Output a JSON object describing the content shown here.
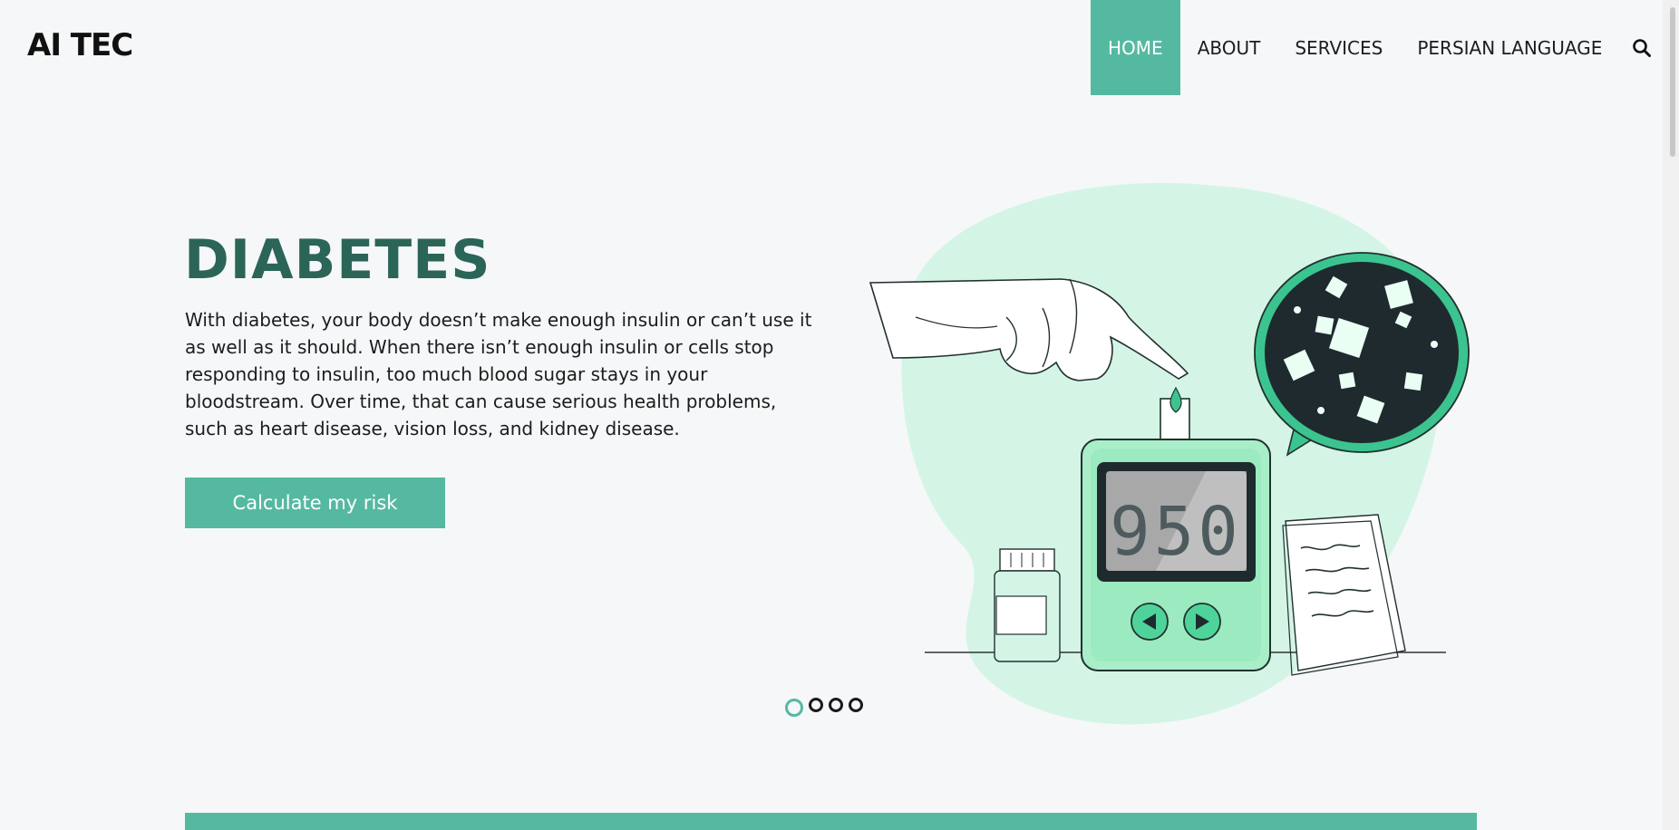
{
  "brand": {
    "logo": "AI TEC"
  },
  "nav": {
    "items": [
      {
        "label": "HOME",
        "active": true
      },
      {
        "label": "ABOUT",
        "active": false
      },
      {
        "label": "SERVICES",
        "active": false
      },
      {
        "label": "PERSIAN LANGUAGE",
        "active": false
      }
    ],
    "search_icon": "search-icon"
  },
  "hero": {
    "title": "DIABETES",
    "description": "With diabetes, your body doesn’t make enough insulin or can’t use it as well as it should. When there isn’t enough insulin or cells stop responding to insulin, too much blood sugar stays in your bloodstream. Over time, that can cause serious health problems, such as heart disease, vision loss, and kidney disease.",
    "cta_label": "Calculate my risk",
    "meter_reading": "950"
  },
  "carousel": {
    "slides": 4,
    "active_index": 0
  },
  "colors": {
    "accent": "#55b9a1",
    "title": "#2b6557",
    "blob": "#d4f5e6",
    "dark": "#1e2a2e",
    "background": "#f5f7f8"
  }
}
